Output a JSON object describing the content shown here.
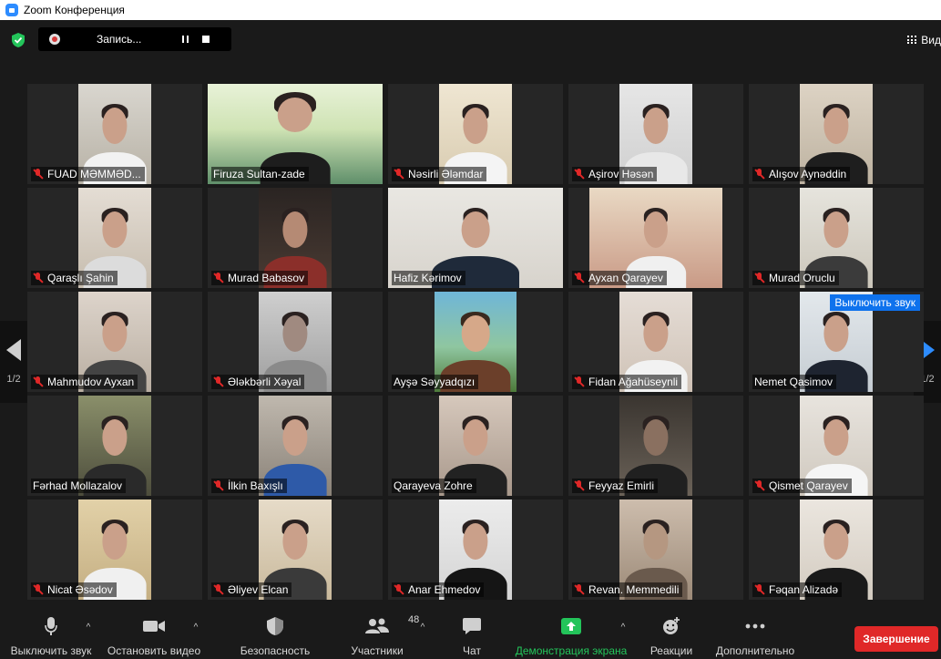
{
  "window": {
    "title": "Zoom Конференция"
  },
  "recording": {
    "label": "Запись..."
  },
  "view": {
    "label": "Вид"
  },
  "pagination": {
    "left": "1/2",
    "right": "1/2"
  },
  "hover_tooltip": "Выключить звук",
  "participants": [
    {
      "name": "FUAD MƏMMƏD...",
      "muted": true
    },
    {
      "name": "Firuza Sultan-zade",
      "muted": false
    },
    {
      "name": "Nəsirli Ələmdar",
      "muted": true
    },
    {
      "name": "Aşirov Həsən",
      "muted": true
    },
    {
      "name": "Alışov Aynəddin",
      "muted": true
    },
    {
      "name": "Qaraşlı Şahin",
      "muted": true
    },
    {
      "name": "Murad Babasov",
      "muted": true
    },
    {
      "name": "Hafiz Kərimov",
      "muted": false
    },
    {
      "name": "Ayxan Qarayev",
      "muted": true
    },
    {
      "name": "Murad Oruclu",
      "muted": true
    },
    {
      "name": "Mahmudov Ayxan",
      "muted": true
    },
    {
      "name": "Ələkbərli Xəyal",
      "muted": true
    },
    {
      "name": "Ayşə Səyyadqızı",
      "muted": false
    },
    {
      "name": "Fidan Ağahüseynli",
      "muted": true
    },
    {
      "name": "Nemet Qasimov",
      "muted": false
    },
    {
      "name": "Fərhad Mollazalov",
      "muted": false
    },
    {
      "name": "İlkin Baxışlı",
      "muted": true
    },
    {
      "name": "Qarayeva Zohre",
      "muted": false
    },
    {
      "name": "Feyyaz Emirli",
      "muted": true
    },
    {
      "name": "Qismet Qarayev",
      "muted": true
    },
    {
      "name": "Nicat Əsədov",
      "muted": true
    },
    {
      "name": "Əliyev Elcan",
      "muted": true
    },
    {
      "name": "Anar Ehmedov",
      "muted": true
    },
    {
      "name": "Revan. Memmedili",
      "muted": true
    },
    {
      "name": "Fəqan Alizadə",
      "muted": true
    }
  ],
  "toolbar": {
    "mute": "Выключить звук",
    "video": "Остановить видео",
    "security": "Безопасность",
    "participants": "Участники",
    "participants_count": "48",
    "chat": "Чат",
    "share": "Демонстрация экрана",
    "reactions": "Реакции",
    "more": "Дополнительно",
    "end": "Завершение"
  },
  "colors": {
    "active_speaker": "#e5e542",
    "end_button": "#e02828",
    "share_green": "#23c45a",
    "tooltip": "#0e72ed"
  }
}
